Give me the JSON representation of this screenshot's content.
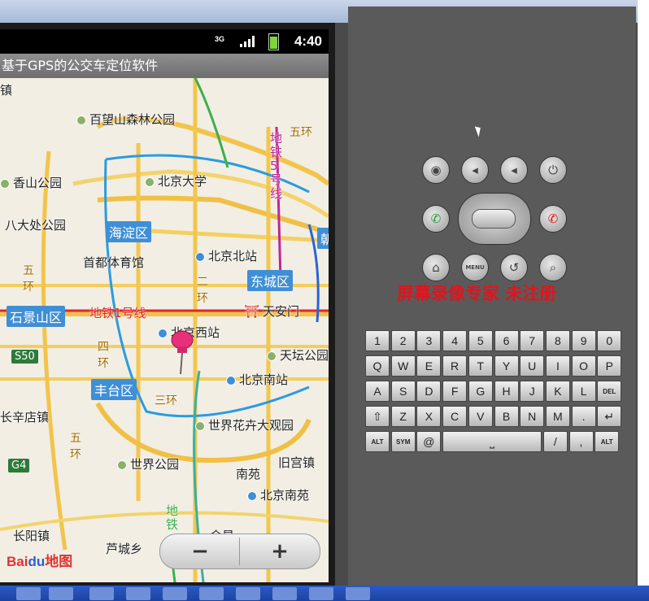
{
  "status_bar": {
    "network": "3G",
    "time": "4:40"
  },
  "app": {
    "title": "基于GPS的公交车定位软件"
  },
  "map": {
    "places": [
      {
        "name": "镇"
      },
      {
        "name": "百望山森林公园"
      },
      {
        "name": "香山公园"
      },
      {
        "name": "北京大学"
      },
      {
        "name": "八大处公园"
      },
      {
        "name": "首都体育馆"
      },
      {
        "name": "北京北站"
      },
      {
        "name": "北京西站"
      },
      {
        "name": "天安门"
      },
      {
        "name": "天坛公园"
      },
      {
        "name": "北京南站"
      },
      {
        "name": "长辛店镇"
      },
      {
        "name": "世界花卉大观园"
      },
      {
        "name": "世界公园"
      },
      {
        "name": "南苑"
      },
      {
        "name": "旧宫镇"
      },
      {
        "name": "北京南苑"
      },
      {
        "name": "长阳镇"
      },
      {
        "name": "芦城乡"
      },
      {
        "name": "金星"
      }
    ],
    "districts": [
      "海淀区",
      "东城区",
      "石景山区",
      "丰台区",
      "朝"
    ],
    "subway_line1": "地铁1号线",
    "subway_line5": "地铁5号线",
    "subway_other": "地铁",
    "rings": [
      "五环",
      "二环",
      "三环",
      "四环",
      "五环",
      "五环"
    ],
    "highway_s50": "S50",
    "highway_g4": "G4",
    "zoom_out": "−",
    "zoom_in": "+",
    "logo_main": "Bai",
    "logo_du": "du",
    "logo_suffix": "地图"
  },
  "emulator": {
    "buttons": [
      {
        "icon": "camera-icon",
        "glyph": "◉"
      },
      {
        "icon": "volume-down-icon",
        "glyph": "◂"
      },
      {
        "icon": "volume-up-icon",
        "glyph": "◂"
      },
      {
        "icon": "power-icon",
        "glyph": "⏻"
      },
      {
        "icon": "call-icon",
        "glyph": "✆"
      },
      {
        "icon": "end-call-icon",
        "glyph": "✆"
      },
      {
        "icon": "home-icon",
        "glyph": "⌂"
      },
      {
        "icon": "menu-icon",
        "glyph": "MENU"
      },
      {
        "icon": "back-icon",
        "glyph": "↺"
      },
      {
        "icon": "search-icon",
        "glyph": "⌕"
      }
    ],
    "watermark": "屏幕录像专家 未注册",
    "keyboard_rows": [
      [
        "1",
        "2",
        "3",
        "4",
        "5",
        "6",
        "7",
        "8",
        "9",
        "0"
      ],
      [
        "Q",
        "W",
        "E",
        "R",
        "T",
        "Y",
        "U",
        "I",
        "O",
        "P"
      ],
      [
        "A",
        "S",
        "D",
        "F",
        "G",
        "H",
        "J",
        "K",
        "L",
        "DEL"
      ],
      [
        "⇧",
        "Z",
        "X",
        "C",
        "V",
        "B",
        "N",
        "M",
        ".",
        "↵"
      ],
      [
        "ALT",
        "SYM",
        "@",
        "⎵",
        "/",
        ",",
        "ALT"
      ]
    ]
  }
}
